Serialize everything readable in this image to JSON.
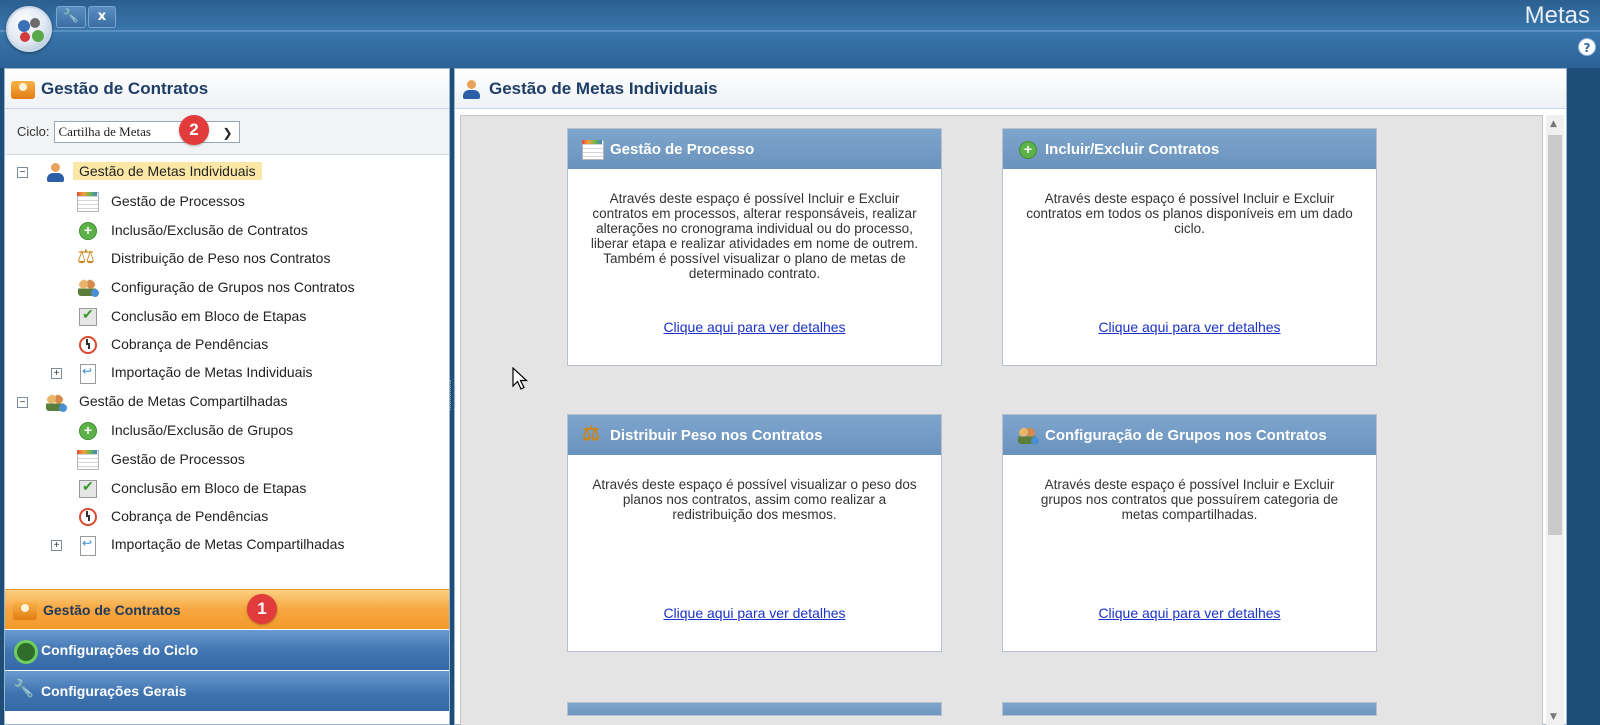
{
  "window": {
    "app_title": "Metas",
    "quick_close": "x",
    "help": "?"
  },
  "left_panel": {
    "title": "Gestão de Contratos",
    "cycle_label": "Ciclo:",
    "cycle_value": "Cartilha de Metas",
    "tree": [
      {
        "label": "Gestão de Metas Individuais",
        "toggle": "−",
        "icon": "user-icon",
        "level": 0,
        "selected": true
      },
      {
        "label": "Gestão de Processos",
        "icon": "process-icon",
        "level": 1
      },
      {
        "label": "Inclusão/Exclusão de Contratos",
        "icon": "add-icon",
        "level": 1
      },
      {
        "label": "Distribuição de Peso nos Contratos",
        "icon": "scale-icon",
        "level": 1
      },
      {
        "label": "Configuração de Grupos nos Contratos",
        "icon": "users-icon",
        "level": 1
      },
      {
        "label": "Conclusão em Bloco de Etapas",
        "icon": "check-icon",
        "level": 1
      },
      {
        "label": "Cobrança de Pendências",
        "icon": "clock-icon",
        "level": 1
      },
      {
        "label": "Importação de Metas Individuais",
        "toggle": "+",
        "icon": "import-icon",
        "level": 1
      },
      {
        "label": "Gestão de Metas Compartilhadas",
        "toggle": "−",
        "icon": "users-icon",
        "level": 0
      },
      {
        "label": "Inclusão/Exclusão de Grupos",
        "icon": "add-icon",
        "level": 1
      },
      {
        "label": "Gestão de Processos",
        "icon": "process-icon",
        "level": 1
      },
      {
        "label": "Conclusão em Bloco de Etapas",
        "icon": "check-icon",
        "level": 1
      },
      {
        "label": "Cobrança de Pendências",
        "icon": "clock-icon",
        "level": 1
      },
      {
        "label": "Importação de Metas Compartilhadas",
        "toggle": "+",
        "icon": "import-icon",
        "level": 1
      }
    ],
    "accordion": [
      {
        "label": "Gestão de Contratos",
        "active": true
      },
      {
        "label": "Configurações do Ciclo",
        "active": false
      },
      {
        "label": "Configurações Gerais",
        "active": false
      }
    ],
    "badges": {
      "b1": "1",
      "b2": "2"
    }
  },
  "right_panel": {
    "title": "Gestão de Metas Individuais",
    "cards": [
      {
        "title": "Gestão de Processo",
        "icon": "process-icon",
        "body": "Através deste espaço é possível Incluir e Excluir contratos em processos, alterar responsáveis, realizar alterações no cronograma individual ou do processo, liberar etapa e realizar atividades em nome de outrem. Também é possível visualizar o plano de metas de determinado contrato.",
        "link": "Clique aqui para ver detalhes"
      },
      {
        "title": "Incluir/Excluir Contratos",
        "icon": "add-icon",
        "body": "Através deste espaço é possível Incluir e Excluir contratos em todos os planos disponíveis em um dado ciclo.",
        "link": "Clique aqui para ver detalhes"
      },
      {
        "title": "Distribuir Peso nos Contratos",
        "icon": "scale-icon",
        "body": "Através deste espaço é possível visualizar o peso dos planos nos contratos, assim como realizar a redistribuição dos mesmos.",
        "link": "Clique aqui para ver detalhes"
      },
      {
        "title": "Configuração de Grupos nos Contratos",
        "icon": "users-icon",
        "body": "Através deste espaço é possível Incluir e Excluir grupos nos contratos que possuírem categoria de metas compartilhadas.",
        "link": "Clique aqui para ver detalhes"
      }
    ]
  },
  "colors": {
    "accent_orange": "#f7a63f",
    "header_blue": "#6a93bd",
    "link_blue": "#1a32c8",
    "title_navy": "#1e3e66"
  }
}
